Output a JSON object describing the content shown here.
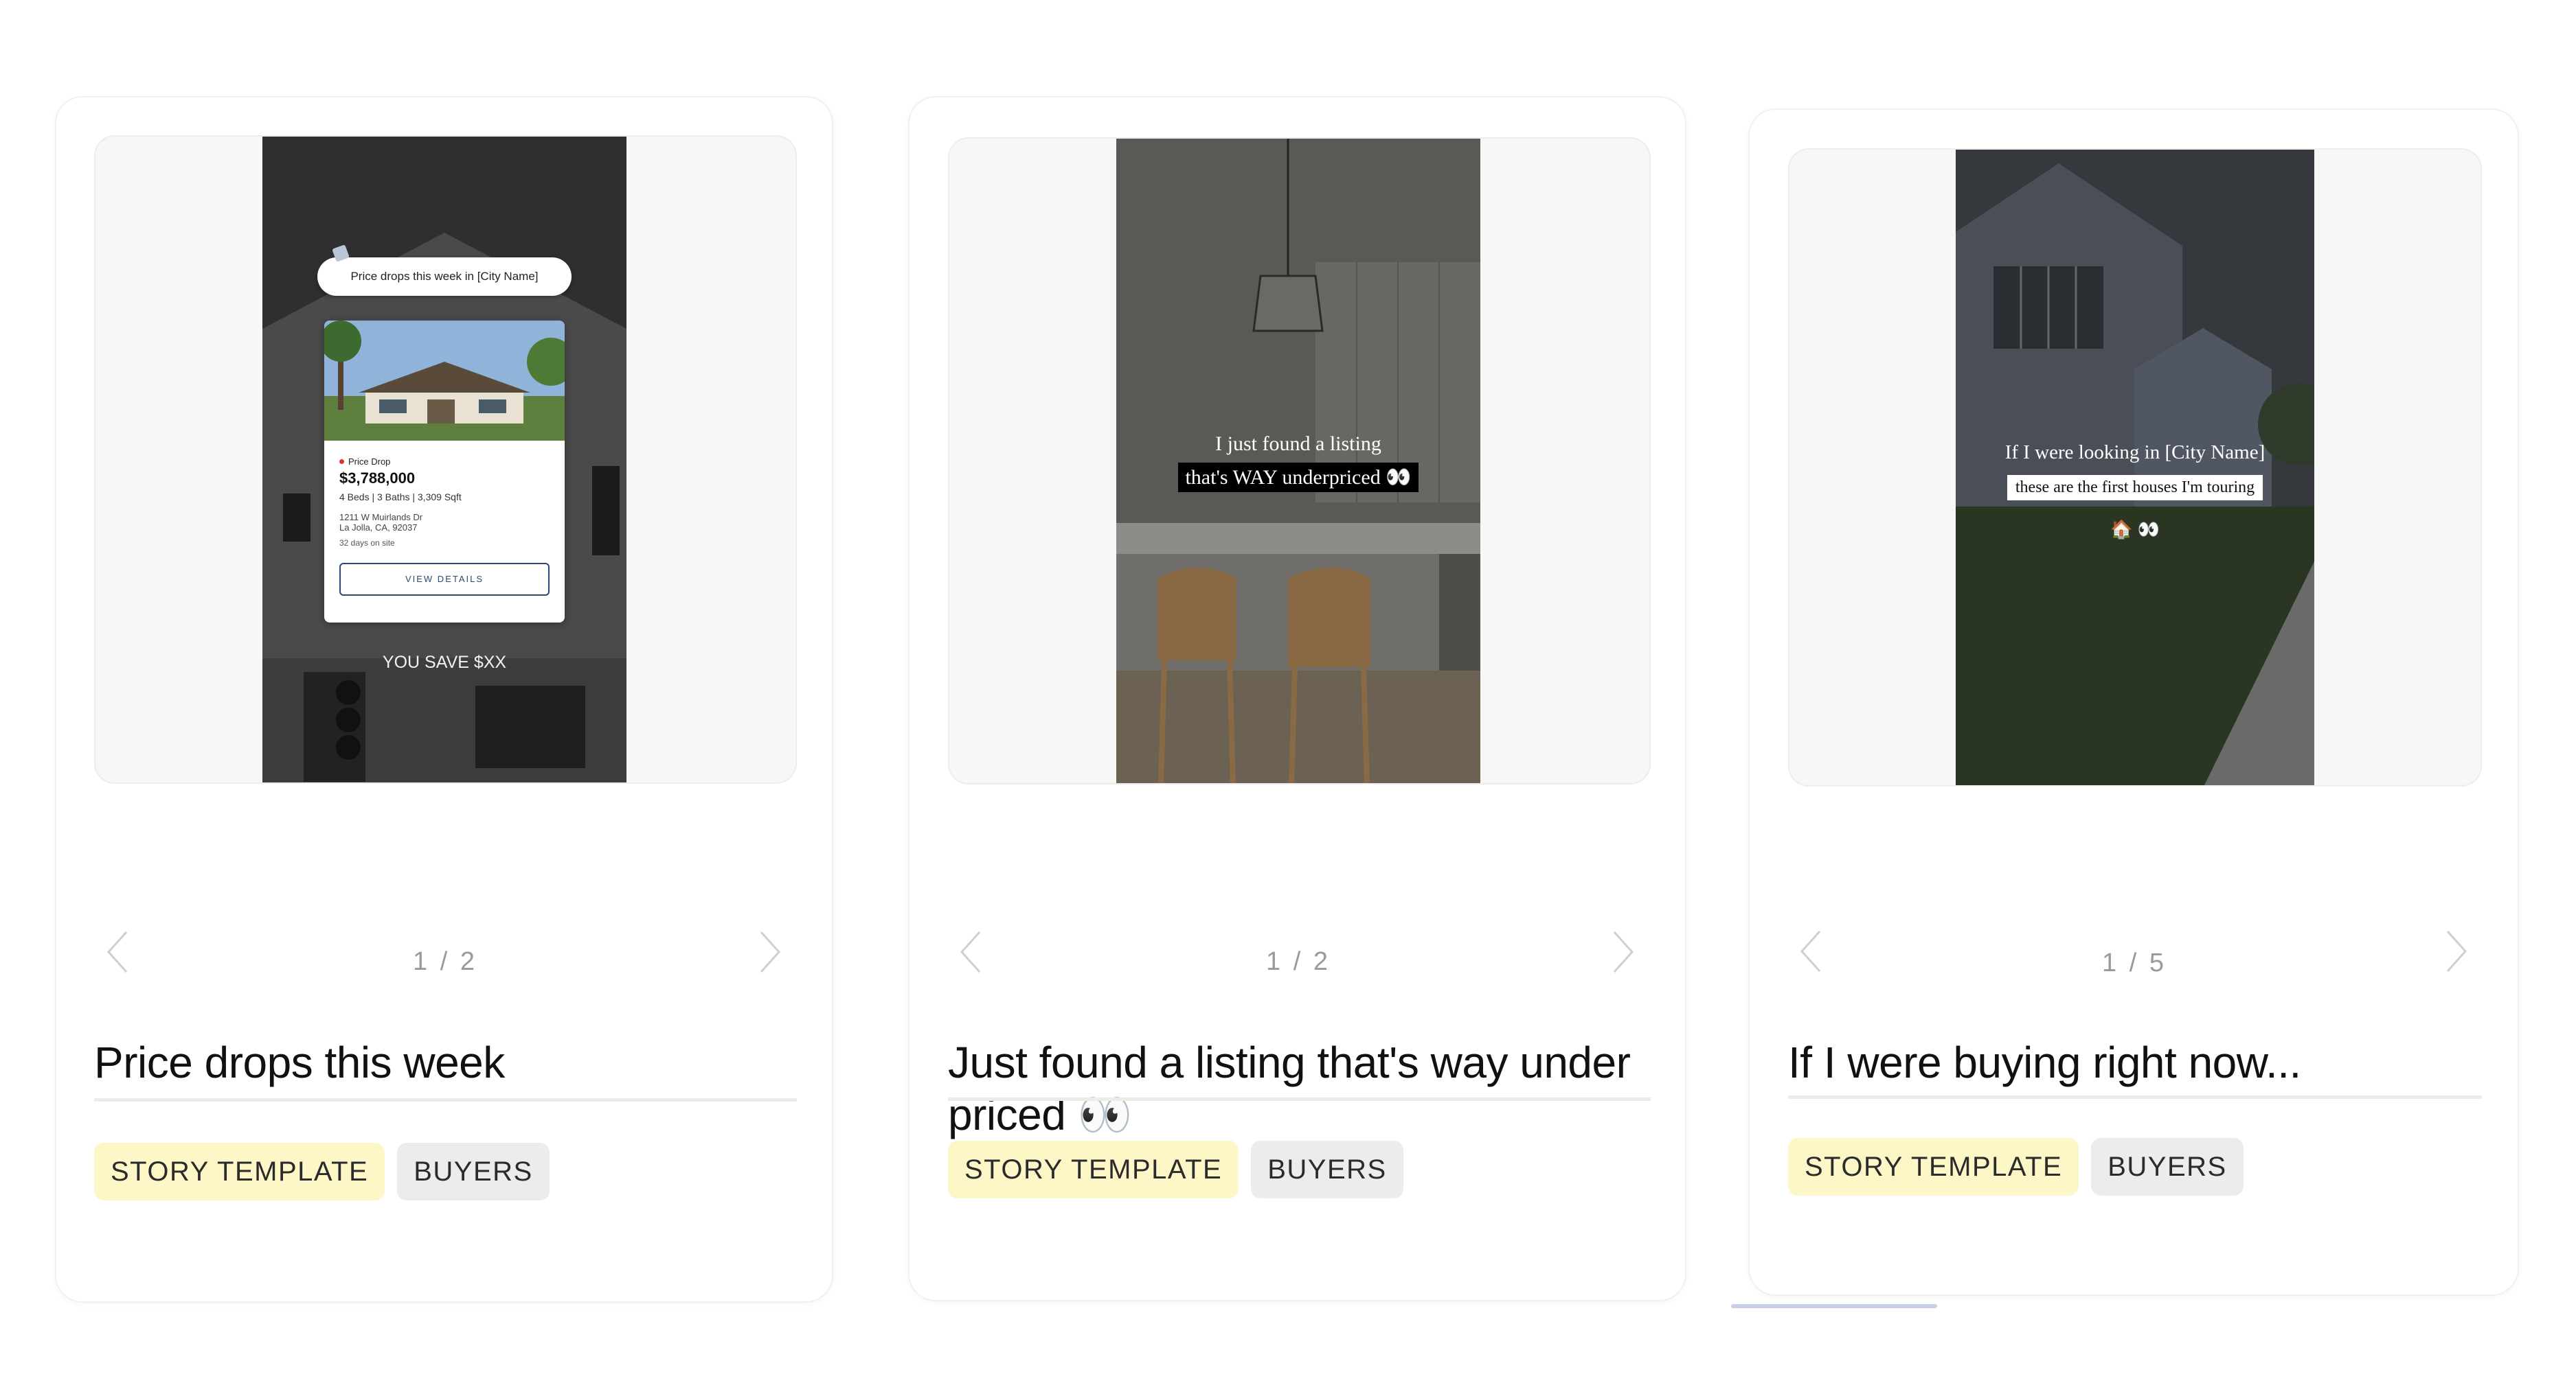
{
  "cards": [
    {
      "counter": "1 / 2",
      "title": "Price drops this week",
      "tags": [
        "STORY TEMPLATE",
        "BUYERS"
      ],
      "preview": {
        "header_pill": "Price drops this week in [City Name]",
        "badge": "Price Drop",
        "price": "$3,788,000",
        "specs": "4 Beds | 3 Baths | 3,309 Sqft",
        "address_line1": "1211 W Muirlands Dr",
        "address_line2": "La Jolla, CA, 92037",
        "days_on_site": "32 days on site",
        "button": "VIEW DETAILS",
        "savings": "YOU SAVE $XX"
      }
    },
    {
      "counter": "1 / 2",
      "title": "Just found a listing that's way under priced 👀",
      "tags": [
        "STORY TEMPLATE",
        "BUYERS"
      ],
      "preview": {
        "line1": "I just found a listing",
        "line2": "that's WAY underpriced 👀"
      }
    },
    {
      "counter": "1 / 5",
      "title": "If I were buying right now...",
      "tags": [
        "STORY TEMPLATE",
        "BUYERS"
      ],
      "preview": {
        "line1": "If I were looking in [City Name]",
        "line2": "these are the first houses I'm touring",
        "line3": "🏠 👀"
      }
    }
  ],
  "colors": {
    "story_tag_bg": "#fdf6c7",
    "buyers_tag_bg": "#ececec",
    "divider": "#eeece6",
    "accent_button": "#2c4a6e"
  },
  "icons": [
    "chevron-left-icon",
    "chevron-right-icon"
  ]
}
